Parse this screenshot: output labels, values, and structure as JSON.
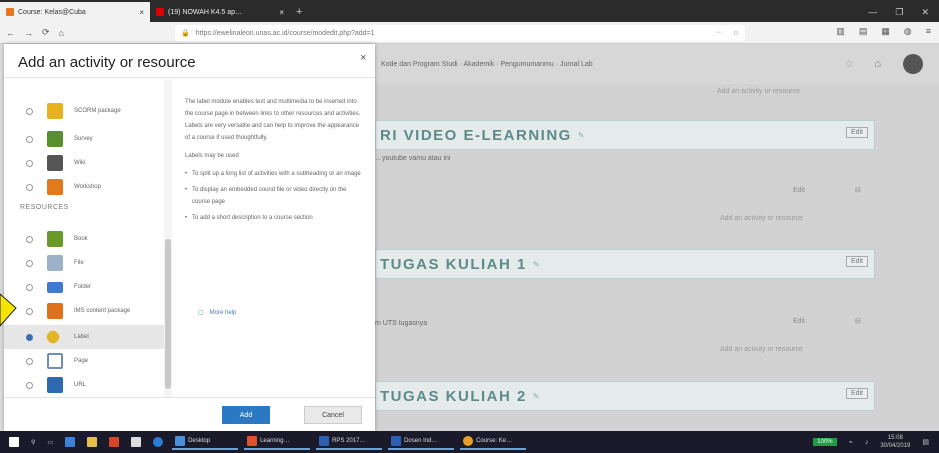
{
  "browser": {
    "tabs": [
      {
        "label": "Course: Kelas@Cuba",
        "active": true
      },
      {
        "label": "(19) NOWAH K4.5 ap…",
        "active": false
      }
    ],
    "url": "https://ewelinaleon.unas.ac.id/course/modedit.php?add=1",
    "new_tab": "+"
  },
  "moodle": {
    "nav_text": "Kode dan Program Studi · Akademik · Pengumumanmu · Jurnal Lab"
  },
  "course": {
    "top_link": "Add an activity or resource",
    "sections": [
      {
        "title": "RI VIDEO E-LEARNING",
        "edit": "Edit",
        "row": "…youtube vamu atau ini",
        "row_edit": "Edit",
        "add_link": "Add an activity or resource"
      },
      {
        "title": "TUGAS KULIAH 1",
        "edit": "Edit",
        "row": "m UTS tugasnya",
        "row_edit": "Edit",
        "add_link": "Add an activity or resource"
      },
      {
        "title": "TUGAS KULIAH 2",
        "edit": "Edit"
      }
    ]
  },
  "modal": {
    "title": "Add an activity or resource",
    "close": "×",
    "items": [
      {
        "label": "SCORM package",
        "color": "#e8b21e",
        "selected": false
      },
      {
        "label": "Survey",
        "color": "#5a8f2d",
        "selected": false
      },
      {
        "label": "Wiki",
        "color": "#555555",
        "selected": false
      },
      {
        "label": "Workshop",
        "color": "#e07a1c",
        "selected": false
      },
      {
        "label": "Book",
        "color": "#6a9a2a",
        "selected": false
      },
      {
        "label": "File",
        "color": "#9db2c8",
        "selected": false
      },
      {
        "label": "Folder",
        "color": "#3d7bd1",
        "selected": false
      },
      {
        "label": "IMS content package",
        "color": "#e0711c",
        "selected": false
      },
      {
        "label": "Label",
        "color": "#e3b62a",
        "selected": true
      },
      {
        "label": "Page",
        "color": "#6f8fb8",
        "selected": false
      },
      {
        "label": "URL",
        "color": "#2d6ab0",
        "selected": false
      }
    ],
    "resources_heading": "RESOURCES",
    "description": {
      "p1": "The label module enables text and multimedia to be inserted into the course page in between links to other resources and activities. Labels are very versatile and can help to improve the appearance of a course if used thoughtfully.",
      "p2": "Labels may be used",
      "bullets": [
        "To split up a long list of activities with a subheading or an image",
        "To display an embedded sound file or video directly on the course page",
        "To add a short description to a course section"
      ]
    },
    "more_help": "More help",
    "add_button": "Add",
    "cancel_button": "Cancel"
  },
  "taskbar": {
    "items": [
      "Desktop",
      "Learning…",
      "RPS 2017…",
      "Dosen Ind…",
      "Course: Ke…"
    ],
    "battery": "100%",
    "clock_time": "15:08",
    "clock_date": "30/04/2019"
  },
  "colors": {
    "accent": "#2b79c2",
    "section_title": "#5c8b8a",
    "pointer": "#f5e400"
  }
}
